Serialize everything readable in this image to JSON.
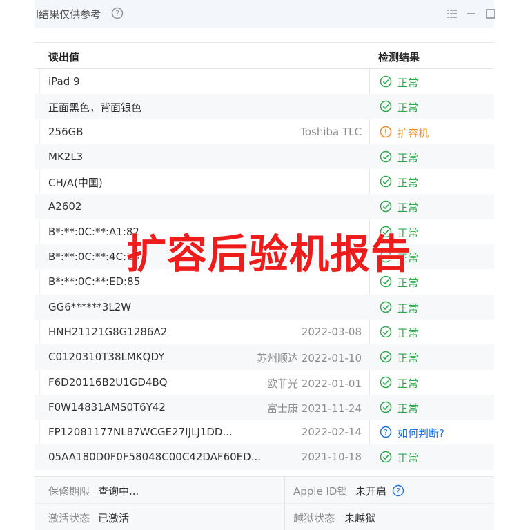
{
  "window": {
    "title": "验机结果仅供参考",
    "title_visible": "l结果仅供参考",
    "controls": [
      "list-icon",
      "minimize-icon",
      "maximize-icon"
    ]
  },
  "table": {
    "headers": {
      "read_value": "读出值",
      "result": "检测结果"
    },
    "rows": [
      {
        "value": "iPad 9",
        "note": "",
        "status": "ok",
        "result": "正常"
      },
      {
        "value": "正面黑色，背面银色",
        "note": "",
        "status": "ok",
        "result": "正常"
      },
      {
        "value": "256GB",
        "note": "Toshiba TLC",
        "status": "warn",
        "result": "扩容机"
      },
      {
        "value": "MK2L3",
        "note": "",
        "status": "ok",
        "result": "正常"
      },
      {
        "value": "CH/A(中国)",
        "note": "",
        "status": "ok",
        "result": "正常"
      },
      {
        "value": "A2602",
        "note": "",
        "status": "ok",
        "result": "正常"
      },
      {
        "value": "B*:**:0C:**:A1:82",
        "note": "",
        "status": "ok",
        "result": "正常"
      },
      {
        "value": "B*:**:0C:**:4C:10",
        "note": "",
        "status": "ok",
        "result": "正常"
      },
      {
        "value": "B*:**:0C:**:ED:85",
        "note": "",
        "status": "ok",
        "result": "正常"
      },
      {
        "value": "GG6******3L2W",
        "note": "",
        "status": "ok",
        "result": "正常"
      },
      {
        "value": "HNH21121G8G1286A2",
        "note": "2022-03-08",
        "status": "ok",
        "result": "正常"
      },
      {
        "value": "C0120310T38LMKQDY",
        "note": "苏州顺达 2022-01-10",
        "status": "ok",
        "result": "正常"
      },
      {
        "value": "F6D20116B2U1GD4BQ",
        "note": "欧菲光 2022-01-01",
        "status": "ok",
        "result": "正常"
      },
      {
        "value": "F0W14831AMS0T6Y42",
        "note": "富士康 2021-11-24",
        "status": "ok",
        "result": "正常"
      },
      {
        "value": "FP12081177NL87WCGE27IJLJ1DD...",
        "note": "2022-02-14",
        "status": "unknown",
        "result": "如何判断?"
      },
      {
        "value": "05AA180D0F0F58048C00C42DAF60ED...",
        "note": "2021-10-18",
        "status": "ok",
        "result": "正常"
      }
    ]
  },
  "watermark": "扩容后验机报告",
  "info": {
    "warranty_label": "保修期限",
    "warranty_value": "查询中...",
    "appleid_label": "Apple ID锁",
    "appleid_value": "未开启",
    "activation_label": "激活状态",
    "activation_value": "已激活",
    "jailbreak_label": "越狱状态",
    "jailbreak_value": "未越狱"
  },
  "colors": {
    "ok": "#2aa84a",
    "warn": "#f08c1a",
    "link": "#1a73e8",
    "watermark": "#ef1c1c"
  }
}
